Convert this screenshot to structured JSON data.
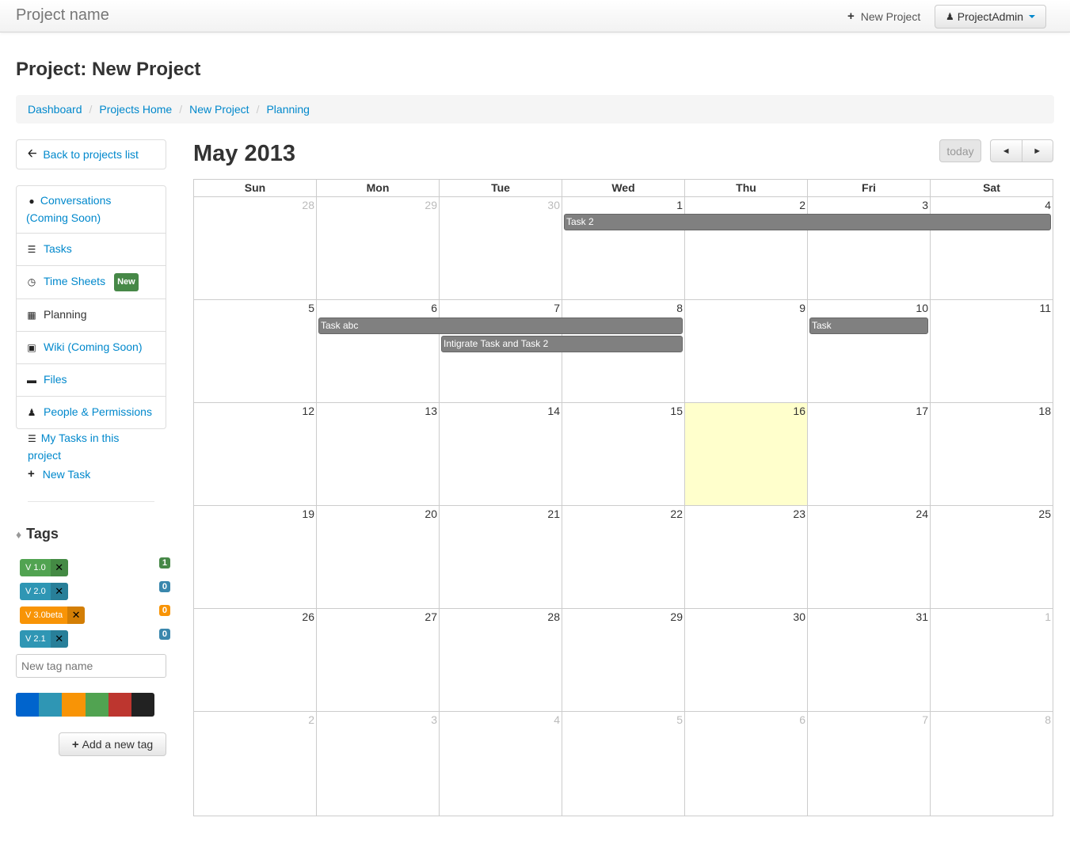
{
  "navbar": {
    "brand": "Project name",
    "new_project": "New Project",
    "user": "ProjectAdmin"
  },
  "page_title": "Project: New Project",
  "breadcrumb": [
    "Dashboard",
    "Projects Home",
    "New Project",
    "Planning"
  ],
  "sidebar": {
    "back": "Back to projects list",
    "items": [
      {
        "label": "Conversations (Coming Soon)",
        "icon": "comment-icon"
      },
      {
        "label": "Tasks",
        "icon": "list-icon"
      },
      {
        "label": "Time Sheets",
        "icon": "time-icon",
        "badge": "New"
      },
      {
        "label": "Planning",
        "icon": "calendar-icon"
      },
      {
        "label": "Wiki (Coming Soon)",
        "icon": "file-icon"
      },
      {
        "label": "Files",
        "icon": "folder-icon"
      },
      {
        "label": "People & Permissions",
        "icon": "user-icon"
      }
    ],
    "my_tasks": "My Tasks in this project",
    "new_task": "New Task"
  },
  "tags": {
    "title": "Tags",
    "list": [
      {
        "name": "V 1.0",
        "count": "1",
        "color": "#51a351"
      },
      {
        "name": "V 2.0",
        "count": "0",
        "color": "#2f96b4"
      },
      {
        "name": "V 3.0beta",
        "count": "0",
        "color": "#f89406"
      },
      {
        "name": "V 2.1",
        "count": "0",
        "color": "#2f96b4"
      }
    ],
    "input_placeholder": "New tag name",
    "swatches": [
      "#0064cd",
      "#2f96b4",
      "#f89406",
      "#51a351",
      "#bd362f",
      "#222222"
    ],
    "add_button": "Add a new tag"
  },
  "calendar": {
    "title": "May 2013",
    "today_btn": "today",
    "prev": "◄",
    "next": "►",
    "weekdays": [
      "Sun",
      "Mon",
      "Tue",
      "Wed",
      "Thu",
      "Fri",
      "Sat"
    ],
    "weeks": [
      [
        "28",
        "29",
        "30",
        "1",
        "2",
        "3",
        "4"
      ],
      [
        "5",
        "6",
        "7",
        "8",
        "9",
        "10",
        "11"
      ],
      [
        "12",
        "13",
        "14",
        "15",
        "16",
        "17",
        "18"
      ],
      [
        "19",
        "20",
        "21",
        "22",
        "23",
        "24",
        "25"
      ],
      [
        "26",
        "27",
        "28",
        "29",
        "30",
        "31",
        "1"
      ],
      [
        "2",
        "3",
        "4",
        "5",
        "6",
        "7",
        "8"
      ]
    ],
    "events": [
      {
        "title": "Task 2"
      },
      {
        "title": "Task abc"
      },
      {
        "title": "Intigrate Task and Task 2"
      },
      {
        "title": "Task"
      }
    ]
  }
}
